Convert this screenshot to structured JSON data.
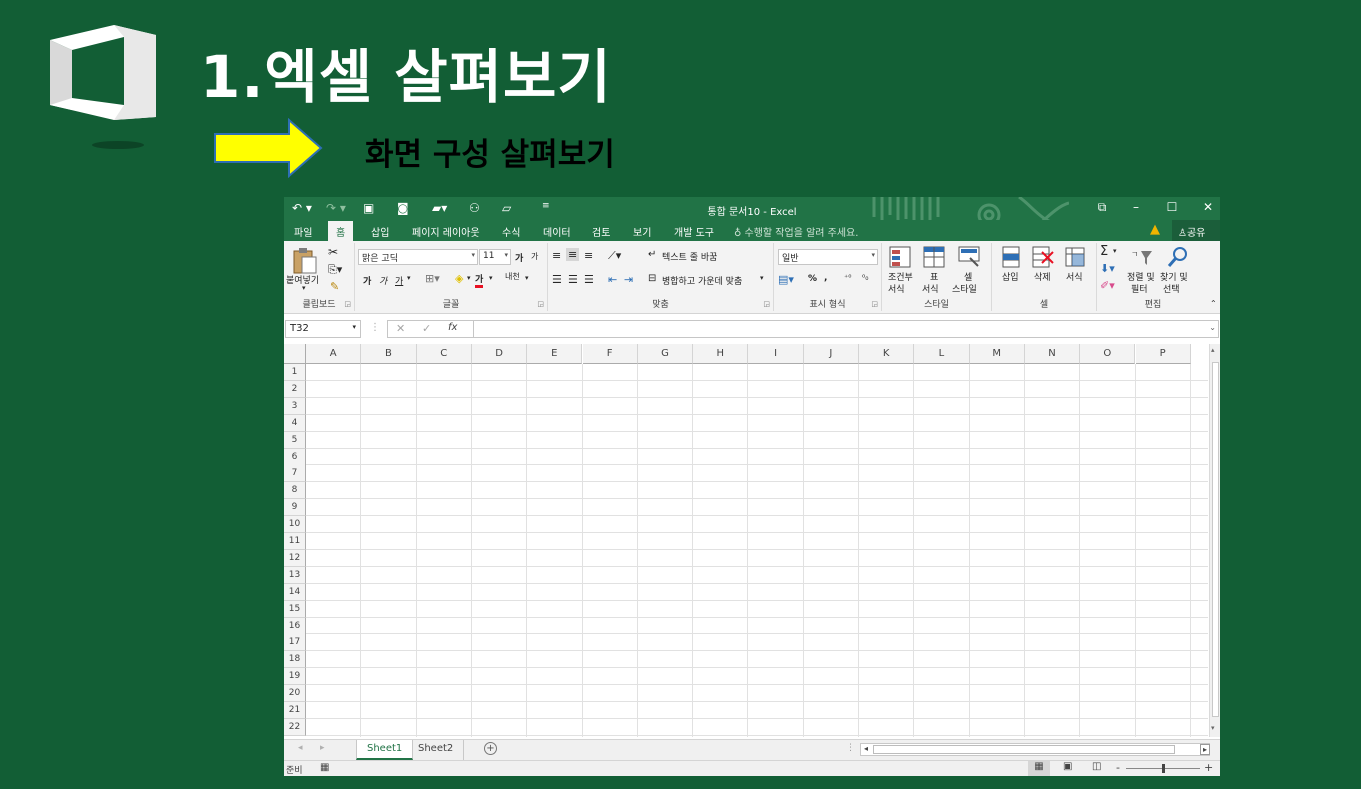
{
  "slide": {
    "title": "1.엑셀 살펴보기",
    "subtitle": "화면 구성 살펴보기",
    "arrow_color": "#ffff00"
  },
  "excel": {
    "window_title": "통합 문서10 - Excel",
    "accent_color": "#217346",
    "quick_access": [
      "undo-icon",
      "redo-icon",
      "save-icon",
      "camera-icon",
      "toolbox-icon",
      "tree-icon",
      "folder-icon",
      "customize-icon"
    ],
    "window_buttons": [
      "ribbon-display-icon",
      "minimize-icon",
      "maximize-icon",
      "close-icon"
    ],
    "tabs": [
      "파일",
      "홈",
      "삽입",
      "페이지 레이아웃",
      "수식",
      "데이터",
      "검토",
      "보기",
      "개발 도구"
    ],
    "active_tab": "홈",
    "tell_me": "수행할 작업을 알려 주세요.",
    "share": "공유",
    "ribbon": {
      "clipboard": {
        "paste": "붙여넣기",
        "label": "클립보드"
      },
      "font": {
        "name": "맑은 고딕",
        "size": "11",
        "grow": "가",
        "shrink": "가",
        "bold": "가",
        "italic": "가",
        "underline": "가",
        "font_color_char": "가",
        "phonetic": "내천",
        "label": "글꼴"
      },
      "alignment": {
        "wrap": "텍스트 줄 바꿈",
        "merge": "병합하고 가운데 맞춤",
        "label": "맞춤"
      },
      "number": {
        "format": "일반",
        "percent": "%",
        "comma": ",",
        "label": "표시 형식"
      },
      "styles": {
        "conditional_1": "조건부",
        "conditional_2": "서식",
        "table_1": "표",
        "table_2": "서식",
        "cell_1": "셀",
        "cell_2": "스타일",
        "label": "스타일"
      },
      "cells": {
        "insert": "삽입",
        "delete": "삭제",
        "format": "서식",
        "label": "셀"
      },
      "editing": {
        "sort_1": "정렬 및",
        "sort_2": "필터",
        "find_1": "찾기 및",
        "find_2": "선택",
        "sigma": "Σ",
        "label": "편집"
      }
    },
    "name_box": "T32",
    "fx": "fx",
    "columns": [
      "A",
      "B",
      "C",
      "D",
      "E",
      "F",
      "G",
      "H",
      "I",
      "J",
      "K",
      "L",
      "M",
      "N",
      "O",
      "P"
    ],
    "rows": [
      "1",
      "2",
      "3",
      "4",
      "5",
      "6",
      "7",
      "8",
      "9",
      "10",
      "11",
      "12",
      "13",
      "14",
      "15",
      "16",
      "17",
      "18",
      "19",
      "20",
      "21",
      "22"
    ],
    "sheets": [
      "Sheet1",
      "Sheet2"
    ],
    "active_sheet": "Sheet1",
    "status": "준비",
    "zoom_minus": "-",
    "zoom_plus": "+"
  }
}
